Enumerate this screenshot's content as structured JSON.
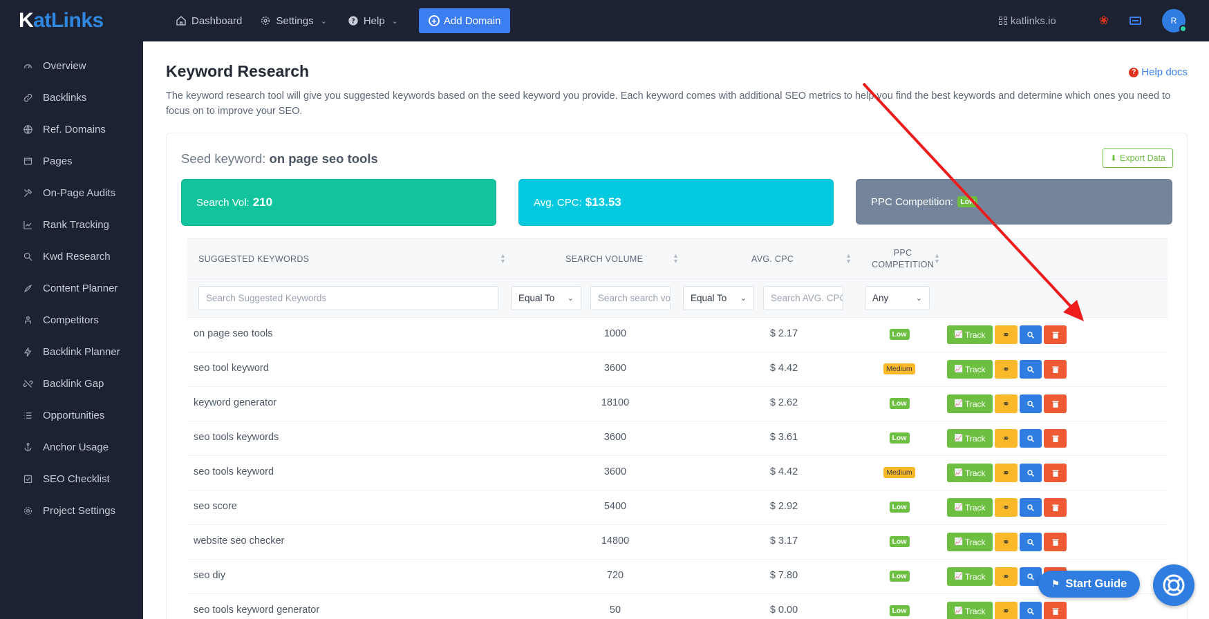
{
  "brand": {
    "prefix": "K",
    "name": "atLinks"
  },
  "sidebar": {
    "items": [
      {
        "label": "Overview",
        "icon": "gauge-icon"
      },
      {
        "label": "Backlinks",
        "icon": "link-icon"
      },
      {
        "label": "Ref. Domains",
        "icon": "globe-icon"
      },
      {
        "label": "Pages",
        "icon": "page-icon"
      },
      {
        "label": "On-Page Audits",
        "icon": "tools-icon"
      },
      {
        "label": "Rank Tracking",
        "icon": "chart-line-icon"
      },
      {
        "label": "Kwd Research",
        "icon": "search-icon"
      },
      {
        "label": "Content Planner",
        "icon": "content-icon"
      },
      {
        "label": "Competitors",
        "icon": "competitors-icon"
      },
      {
        "label": "Backlink Planner",
        "icon": "bolt-icon"
      },
      {
        "label": "Backlink Gap",
        "icon": "unlink-icon"
      },
      {
        "label": "Opportunities",
        "icon": "list-icon"
      },
      {
        "label": "Anchor Usage",
        "icon": "anchor-icon"
      },
      {
        "label": "SEO Checklist",
        "icon": "checklist-icon"
      },
      {
        "label": "Project Settings",
        "icon": "gear-icon"
      }
    ]
  },
  "topbar": {
    "dashboard": "Dashboard",
    "settings": "Settings",
    "help": "Help",
    "add_domain": "Add Domain",
    "site": "katlinks.io",
    "avatar_initial": "R"
  },
  "page": {
    "title": "Keyword Research",
    "help_docs": "Help docs",
    "description": "The keyword research tool will give you suggested keywords based on the seed keyword you provide. Each keyword comes with additional SEO metrics to help you find the best keywords and determine which ones you need to focus on to improve your SEO."
  },
  "seed": {
    "label": "Seed keyword:",
    "value": "on page seo tools"
  },
  "export_label": "Export Data",
  "stats": {
    "search_vol_label": "Search Vol:",
    "search_vol_value": "210",
    "cpc_label": "Avg. CPC:",
    "cpc_value": "$13.53",
    "ppc_label": "PPC Competition:",
    "ppc_value": "Low"
  },
  "table": {
    "headers": {
      "keywords": "SUGGESTED KEYWORDS",
      "volume": "SEARCH VOLUME",
      "cpc": "AVG. CPC",
      "ppc_line1": "PPC",
      "ppc_line2": "COMPETITION"
    },
    "filters": {
      "keywords_placeholder": "Search Suggested Keywords",
      "vol_op": "Equal To",
      "vol_placeholder": "Search search vol",
      "cpc_op": "Equal To",
      "cpc_placeholder": "Search AVG. CPC",
      "ppc_select": "Any"
    },
    "track_label": "Track",
    "rows": [
      {
        "keyword": "on page seo tools",
        "volume": "1000",
        "cpc": "$ 2.17",
        "ppc": "Low"
      },
      {
        "keyword": "seo tool keyword",
        "volume": "3600",
        "cpc": "$ 4.42",
        "ppc": "Medium"
      },
      {
        "keyword": "keyword generator",
        "volume": "18100",
        "cpc": "$ 2.62",
        "ppc": "Low"
      },
      {
        "keyword": "seo tools keywords",
        "volume": "3600",
        "cpc": "$ 3.61",
        "ppc": "Low"
      },
      {
        "keyword": "seo tools keyword",
        "volume": "3600",
        "cpc": "$ 4.42",
        "ppc": "Medium"
      },
      {
        "keyword": "seo score",
        "volume": "5400",
        "cpc": "$ 2.92",
        "ppc": "Low"
      },
      {
        "keyword": "website seo checker",
        "volume": "14800",
        "cpc": "$ 3.17",
        "ppc": "Low"
      },
      {
        "keyword": "seo diy",
        "volume": "720",
        "cpc": "$ 7.80",
        "ppc": "Low"
      },
      {
        "keyword": "seo tools keyword generator",
        "volume": "50",
        "cpc": "$ 0.00",
        "ppc": "Low"
      }
    ]
  },
  "start_guide": "Start Guide",
  "colors": {
    "sidebar_bg": "#1d2233",
    "accent_blue": "#3c7ef2",
    "green": "#6cbf40",
    "teal": "#11c49e",
    "cyan": "#04c9df",
    "slate": "#74849a",
    "annotation_arrow": "#ee1c1c"
  }
}
